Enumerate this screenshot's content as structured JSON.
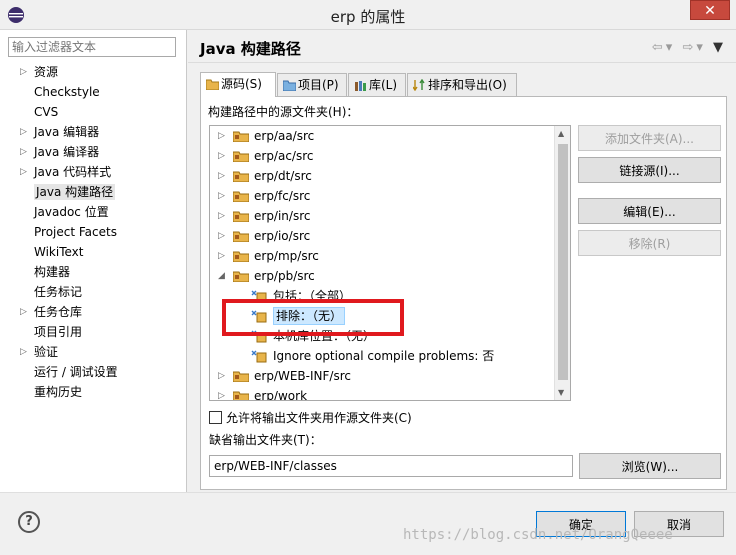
{
  "window": {
    "title": "erp 的属性",
    "close_icon": "✕"
  },
  "left": {
    "filter_placeholder": "输入过滤器文本",
    "items": [
      {
        "label": "资源",
        "expandable": true
      },
      {
        "label": "Checkstyle",
        "expandable": false
      },
      {
        "label": "CVS",
        "expandable": false
      },
      {
        "label": "Java 编辑器",
        "expandable": true
      },
      {
        "label": "Java 编译器",
        "expandable": true
      },
      {
        "label": "Java 代码样式",
        "expandable": true
      },
      {
        "label": "Java 构建路径",
        "expandable": false,
        "selected": true
      },
      {
        "label": "Javadoc 位置",
        "expandable": false
      },
      {
        "label": "Project Facets",
        "expandable": false
      },
      {
        "label": "WikiText",
        "expandable": false
      },
      {
        "label": "构建器",
        "expandable": false
      },
      {
        "label": "任务标记",
        "expandable": false
      },
      {
        "label": "任务仓库",
        "expandable": true
      },
      {
        "label": "项目引用",
        "expandable": false
      },
      {
        "label": "验证",
        "expandable": true
      },
      {
        "label": "运行 / 调试设置",
        "expandable": false
      },
      {
        "label": "重构历史",
        "expandable": false
      }
    ]
  },
  "header": {
    "title": "Java 构建路径",
    "nav_icons": [
      "back-arrow-icon",
      "forward-arrow-icon",
      "menu-icon"
    ]
  },
  "tabs": [
    {
      "label": "源码(S)",
      "active": true
    },
    {
      "label": "项目(P)",
      "active": false
    },
    {
      "label": "库(L)",
      "active": false
    },
    {
      "label": "排序和导出(O)",
      "active": false
    }
  ],
  "source": {
    "label": "构建路径中的源文件夹(H)：",
    "folders": [
      {
        "label": "erp/aa/src",
        "expanded": false
      },
      {
        "label": "erp/ac/src",
        "expanded": false
      },
      {
        "label": "erp/dt/src",
        "expanded": false
      },
      {
        "label": "erp/fc/src",
        "expanded": false
      },
      {
        "label": "erp/in/src",
        "expanded": false
      },
      {
        "label": "erp/io/src",
        "expanded": false
      },
      {
        "label": "erp/mp/src",
        "expanded": false
      },
      {
        "label": "erp/pb/src",
        "expanded": true
      }
    ],
    "children": [
      {
        "label": "包括：（全部）",
        "selected": false
      },
      {
        "label": "排除：（无）",
        "selected": true
      },
      {
        "label": "本机库位置：（无）",
        "selected": false
      },
      {
        "label": "Ignore optional compile problems: 否",
        "selected": false
      }
    ],
    "more_folders": [
      {
        "label": "erp/WEB-INF/src"
      },
      {
        "label": "erp/work"
      }
    ]
  },
  "buttons": {
    "add_folder": "添加文件夹(A)...",
    "link_source": "链接源(I)...",
    "edit": "编辑(E)...",
    "remove": "移除(R)",
    "browse": "浏览(W)...",
    "ok": "确定",
    "cancel": "取消"
  },
  "allow_output_checkbox": {
    "label": "允许将输出文件夹用作源文件夹(C)",
    "checked": false
  },
  "output": {
    "label": "缺省输出文件夹(T)：",
    "value": "erp/WEB-INF/classes"
  },
  "watermark": "https://blog.csdn.net/OrangQeeee",
  "colors": {
    "highlight_box": "#e0191e",
    "selection_bg": "#cce8ff",
    "close_button": "#c7493d"
  }
}
